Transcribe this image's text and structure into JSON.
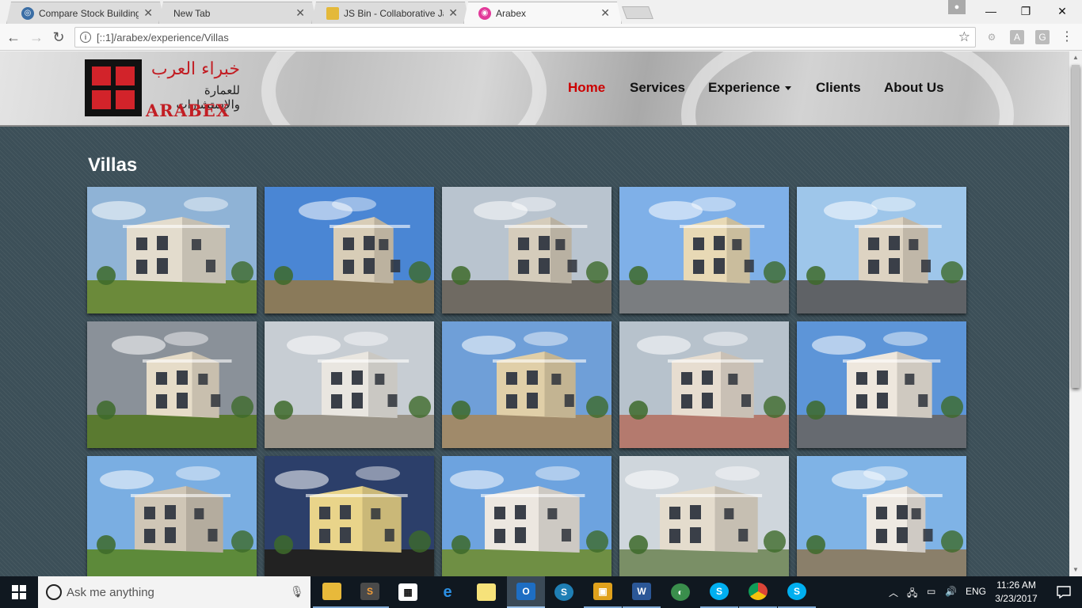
{
  "browser": {
    "tabs": [
      {
        "title": "Compare Stock Building",
        "favicon": "compare-icon",
        "active": false
      },
      {
        "title": "New Tab",
        "favicon": "none",
        "active": false
      },
      {
        "title": "JS Bin - Collaborative Jav",
        "favicon": "jsbin-icon",
        "active": false
      },
      {
        "title": "Arabex",
        "favicon": "arabex-icon",
        "active": true
      }
    ],
    "url": "[::1]/arabex/experience/Villas",
    "window_controls": {
      "minimize": "—",
      "restore": "❐",
      "close": "✕"
    }
  },
  "site": {
    "logo": {
      "arabic_line1": "خبراء العرب",
      "arabic_line2": "للعمارة والإستشارات",
      "latin": "ARABEX"
    },
    "nav": [
      {
        "label": "Home",
        "active": true
      },
      {
        "label": "Services",
        "active": false
      },
      {
        "label": "Experience",
        "active": false,
        "dropdown": true
      },
      {
        "label": "Clients",
        "active": false
      },
      {
        "label": "About Us",
        "active": false
      }
    ],
    "accent_color": "#cc0000",
    "page_title": "Villas",
    "gallery_count": 15
  },
  "taskbar": {
    "search_placeholder": "Ask me anything",
    "language": "ENG",
    "time": "11:26 AM",
    "date": "3/23/2017",
    "apps": [
      "file-explorer",
      "sublime-text",
      "store",
      "edge",
      "sticky-notes",
      "outlook",
      "app-s",
      "sandboxie",
      "word",
      "network-app",
      "skype",
      "chrome",
      "skype-business"
    ]
  }
}
